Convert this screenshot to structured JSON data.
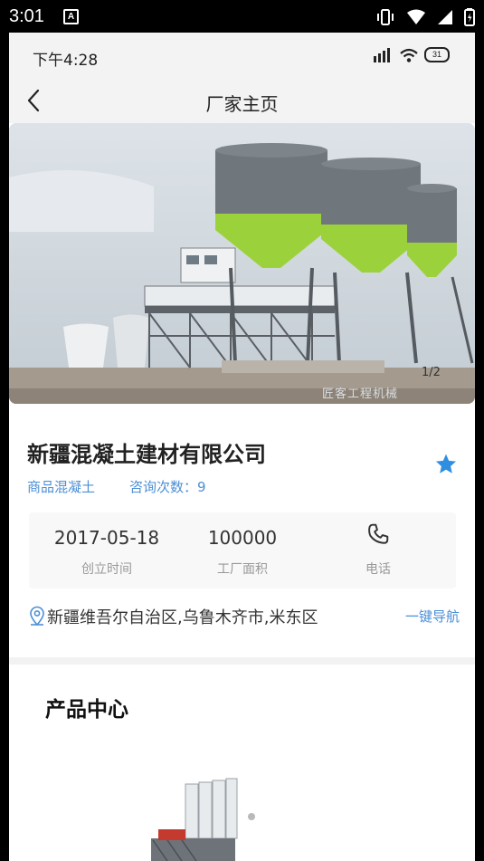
{
  "system_status": {
    "time": "3:01",
    "notification_icon": "A"
  },
  "inner_status": {
    "time": "下午4:28",
    "battery": "31"
  },
  "header": {
    "title": "厂家主页",
    "back_icon": "chevron-left-icon"
  },
  "gallery": {
    "counter": "1/2",
    "watermark": "匠客工程机械"
  },
  "company": {
    "name": "新疆混凝土建材有限公司",
    "category": "商品混凝土",
    "inquiries": "咨询次数：9",
    "favorite_color": "#2f8ee0"
  },
  "stats": [
    {
      "value": "2017-05-18",
      "label": "创立时间"
    },
    {
      "value": "100000",
      "label": "工厂面积"
    },
    {
      "icon": "phone-icon",
      "label": "电话"
    }
  ],
  "address": {
    "text": "新疆维吾尔自治区,乌鲁木齐市,米东区",
    "nav_label": "一键导航"
  },
  "products": {
    "title": "产品中心"
  },
  "colors": {
    "accent": "#4d8fd6",
    "plant_green": "#9bd23c"
  }
}
